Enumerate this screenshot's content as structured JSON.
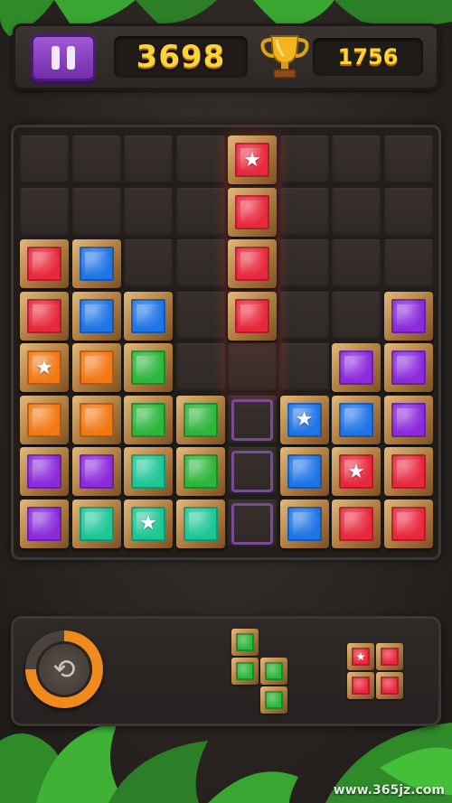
{
  "header": {
    "score": "3698",
    "best_score": "1756"
  },
  "colors": {
    "red": "#e8283c",
    "blue": "#1f74e6",
    "purple": "#8b2bdc",
    "orange": "#f27814",
    "green": "#2db53c",
    "teal": "#1ec696",
    "accent_gold": "#ffd23a"
  },
  "board": {
    "columns": 8,
    "rows": 8,
    "gems": [
      {
        "row": 0,
        "col": 4,
        "color": "red",
        "star": true
      },
      {
        "row": 1,
        "col": 4,
        "color": "red",
        "star": false
      },
      {
        "row": 2,
        "col": 4,
        "color": "red",
        "star": false
      },
      {
        "row": 3,
        "col": 4,
        "color": "red",
        "star": false
      },
      {
        "row": 2,
        "col": 0,
        "color": "red",
        "star": false
      },
      {
        "row": 2,
        "col": 1,
        "color": "blue",
        "star": false
      },
      {
        "row": 3,
        "col": 0,
        "color": "red",
        "star": false
      },
      {
        "row": 3,
        "col": 1,
        "color": "blue",
        "star": false
      },
      {
        "row": 3,
        "col": 2,
        "color": "blue",
        "star": false
      },
      {
        "row": 3,
        "col": 7,
        "color": "purple",
        "star": false
      },
      {
        "row": 4,
        "col": 0,
        "color": "orange",
        "star": true
      },
      {
        "row": 4,
        "col": 1,
        "color": "orange",
        "star": false
      },
      {
        "row": 4,
        "col": 2,
        "color": "green",
        "star": false
      },
      {
        "row": 4,
        "col": 6,
        "color": "purple",
        "star": false
      },
      {
        "row": 4,
        "col": 7,
        "color": "purple",
        "star": false
      },
      {
        "row": 5,
        "col": 0,
        "color": "orange",
        "star": false
      },
      {
        "row": 5,
        "col": 1,
        "color": "orange",
        "star": false
      },
      {
        "row": 5,
        "col": 2,
        "color": "green",
        "star": false
      },
      {
        "row": 5,
        "col": 3,
        "color": "green",
        "star": false
      },
      {
        "row": 5,
        "col": 5,
        "color": "blue",
        "star": true
      },
      {
        "row": 5,
        "col": 6,
        "color": "blue",
        "star": false
      },
      {
        "row": 5,
        "col": 7,
        "color": "purple",
        "star": false
      },
      {
        "row": 6,
        "col": 0,
        "color": "purple",
        "star": false
      },
      {
        "row": 6,
        "col": 1,
        "color": "purple",
        "star": false
      },
      {
        "row": 6,
        "col": 2,
        "color": "teal",
        "star": false
      },
      {
        "row": 6,
        "col": 3,
        "color": "green",
        "star": false
      },
      {
        "row": 6,
        "col": 5,
        "color": "blue",
        "star": false
      },
      {
        "row": 6,
        "col": 6,
        "color": "red",
        "star": true
      },
      {
        "row": 6,
        "col": 7,
        "color": "red",
        "star": false
      },
      {
        "row": 7,
        "col": 0,
        "color": "purple",
        "star": false
      },
      {
        "row": 7,
        "col": 1,
        "color": "teal",
        "star": false
      },
      {
        "row": 7,
        "col": 2,
        "color": "teal",
        "star": true
      },
      {
        "row": 7,
        "col": 3,
        "color": "teal",
        "star": false
      },
      {
        "row": 7,
        "col": 5,
        "color": "blue",
        "star": false
      },
      {
        "row": 7,
        "col": 6,
        "color": "red",
        "star": false
      },
      {
        "row": 7,
        "col": 7,
        "color": "red",
        "star": false
      }
    ],
    "drop_hints": [
      {
        "row": 5,
        "col": 4
      },
      {
        "row": 6,
        "col": 4
      },
      {
        "row": 7,
        "col": 4
      }
    ]
  },
  "tray": {
    "rotate_progress": 0.75,
    "pieces": [
      {
        "name": "green-s-piece",
        "blocks": [
          {
            "r": 0,
            "c": 0,
            "color": "green",
            "star": false
          },
          {
            "r": 1,
            "c": 0,
            "color": "green",
            "star": false
          },
          {
            "r": 1,
            "c": 1,
            "color": "green",
            "star": false
          },
          {
            "r": 2,
            "c": 1,
            "color": "green",
            "star": false
          }
        ]
      },
      {
        "name": "red-square-piece",
        "blocks": [
          {
            "r": 0,
            "c": 0,
            "color": "red",
            "star": true
          },
          {
            "r": 0,
            "c": 1,
            "color": "red",
            "star": false
          },
          {
            "r": 1,
            "c": 0,
            "color": "red",
            "star": false
          },
          {
            "r": 1,
            "c": 1,
            "color": "red",
            "star": false
          }
        ]
      }
    ]
  },
  "watermark": "www.365jz.com"
}
